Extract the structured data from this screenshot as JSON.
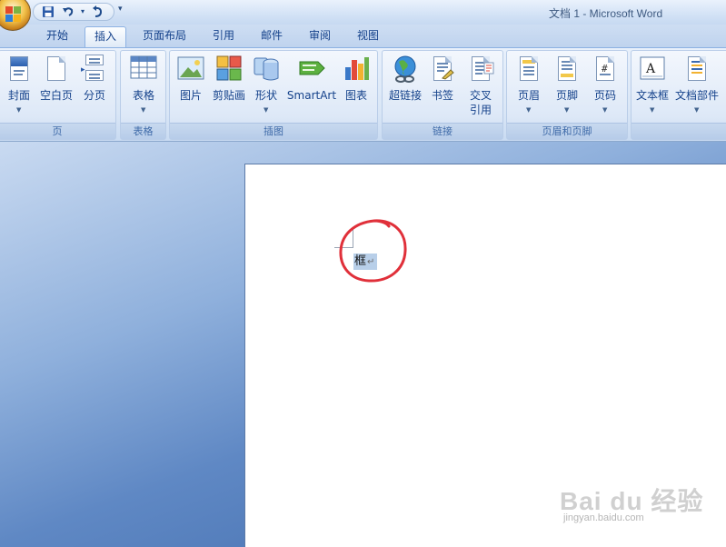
{
  "window": {
    "title": "文档 1 - Microsoft Word"
  },
  "quick_access": {
    "save_icon": "save-icon",
    "undo_icon": "undo-icon",
    "redo_icon": "redo-icon",
    "more_glyph": "▾"
  },
  "tabs": [
    {
      "label": "开始",
      "active": false
    },
    {
      "label": "插入",
      "active": true
    },
    {
      "label": "页面布局",
      "active": false
    },
    {
      "label": "引用",
      "active": false
    },
    {
      "label": "邮件",
      "active": false
    },
    {
      "label": "审阅",
      "active": false
    },
    {
      "label": "视图",
      "active": false
    }
  ],
  "ribbon": {
    "groups": {
      "pages": {
        "label": "页",
        "buttons": [
          "封面",
          "空白页",
          "分页"
        ]
      },
      "tables": {
        "label": "表格",
        "buttons": [
          "表格"
        ]
      },
      "illustrations": {
        "label": "插图",
        "buttons": [
          "图片",
          "剪贴画",
          "形状",
          "SmartArt",
          "图表"
        ]
      },
      "links": {
        "label": "链接",
        "buttons": [
          "超链接",
          "书签",
          "交叉引用"
        ]
      },
      "header_footer": {
        "label": "页眉和页脚",
        "buttons": [
          "页眉",
          "页脚",
          "页码"
        ]
      },
      "text": {
        "label": "",
        "buttons": [
          "文本框",
          "文档部件"
        ]
      }
    },
    "cross_ref_line1": "交叉",
    "cross_ref_line2": "引用"
  },
  "document": {
    "selected_text": "框",
    "paragraph_mark": "↵"
  },
  "watermark": {
    "main": "Bai du 经验",
    "sub": "jingyan.baidu.com"
  },
  "colors": {
    "annotation_circle": "#e0303a",
    "selection": "#b8cfe9",
    "accent": "#15428b"
  }
}
